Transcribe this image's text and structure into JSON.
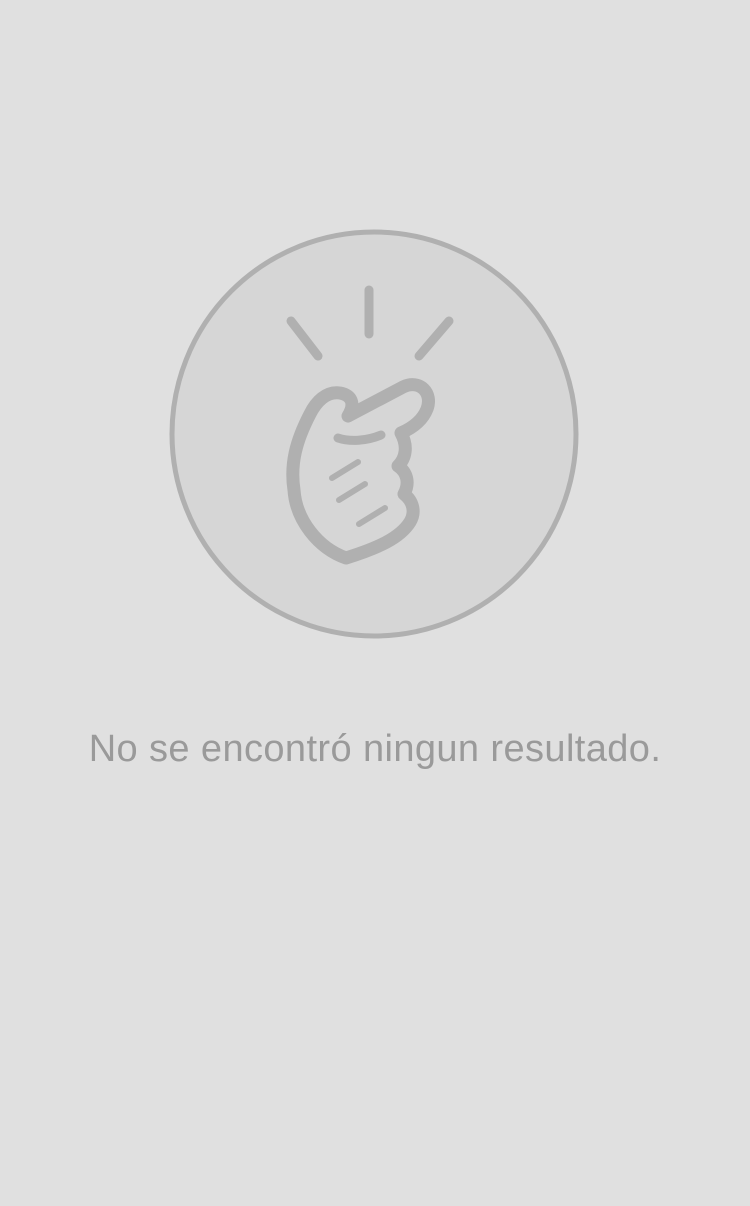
{
  "empty_state": {
    "icon": "snapping-fingers-hand-icon",
    "message": "No se encontró ningun resultado.",
    "colors": {
      "background": "#e0e0e0",
      "circle_fill": "#d6d6d6",
      "circle_stroke": "#b0b0b0",
      "icon_stroke": "#b0b0b0",
      "message_text": "#9a9a9a"
    }
  }
}
